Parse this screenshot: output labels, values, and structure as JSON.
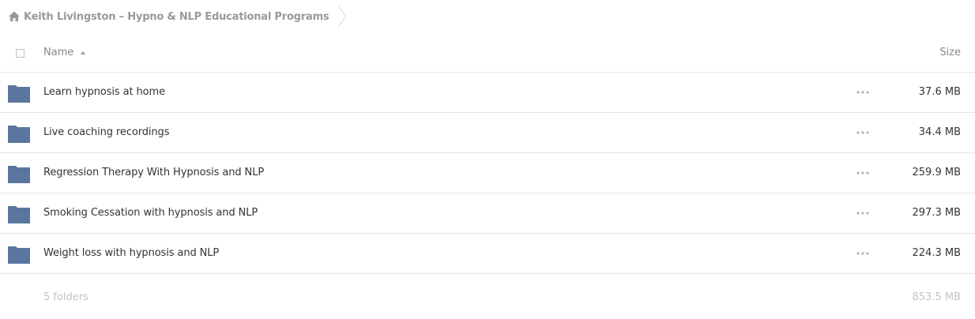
{
  "breadcrumb": {
    "home_icon": "home-icon",
    "label": "Keith Livingston – Hypno & NLP Educational Programs"
  },
  "table": {
    "name_header": "Name",
    "size_header": "Size",
    "sort_icon": "sort-ascending-icon",
    "rows": [
      {
        "icon": "folder-icon",
        "name": "Learn hypnosis at home",
        "size": "37.6 MB"
      },
      {
        "icon": "folder-icon",
        "name": "Live coaching recordings",
        "size": "34.4 MB"
      },
      {
        "icon": "folder-icon",
        "name": "Regression Therapy With Hypnosis and NLP",
        "size": "259.9 MB"
      },
      {
        "icon": "folder-icon",
        "name": "Smoking Cessation with hypnosis and NLP",
        "size": "297.3 MB"
      },
      {
        "icon": "folder-icon",
        "name": "Weight loss with hypnosis and NLP",
        "size": "224.3 MB"
      }
    ]
  },
  "summary": {
    "count": "5 folders",
    "total_size": "853.5 MB"
  },
  "colors": {
    "folder": "#5a769e",
    "muted_text": "#999999",
    "row_border": "#e5e5e5",
    "summary_text": "#c4c4c4"
  }
}
